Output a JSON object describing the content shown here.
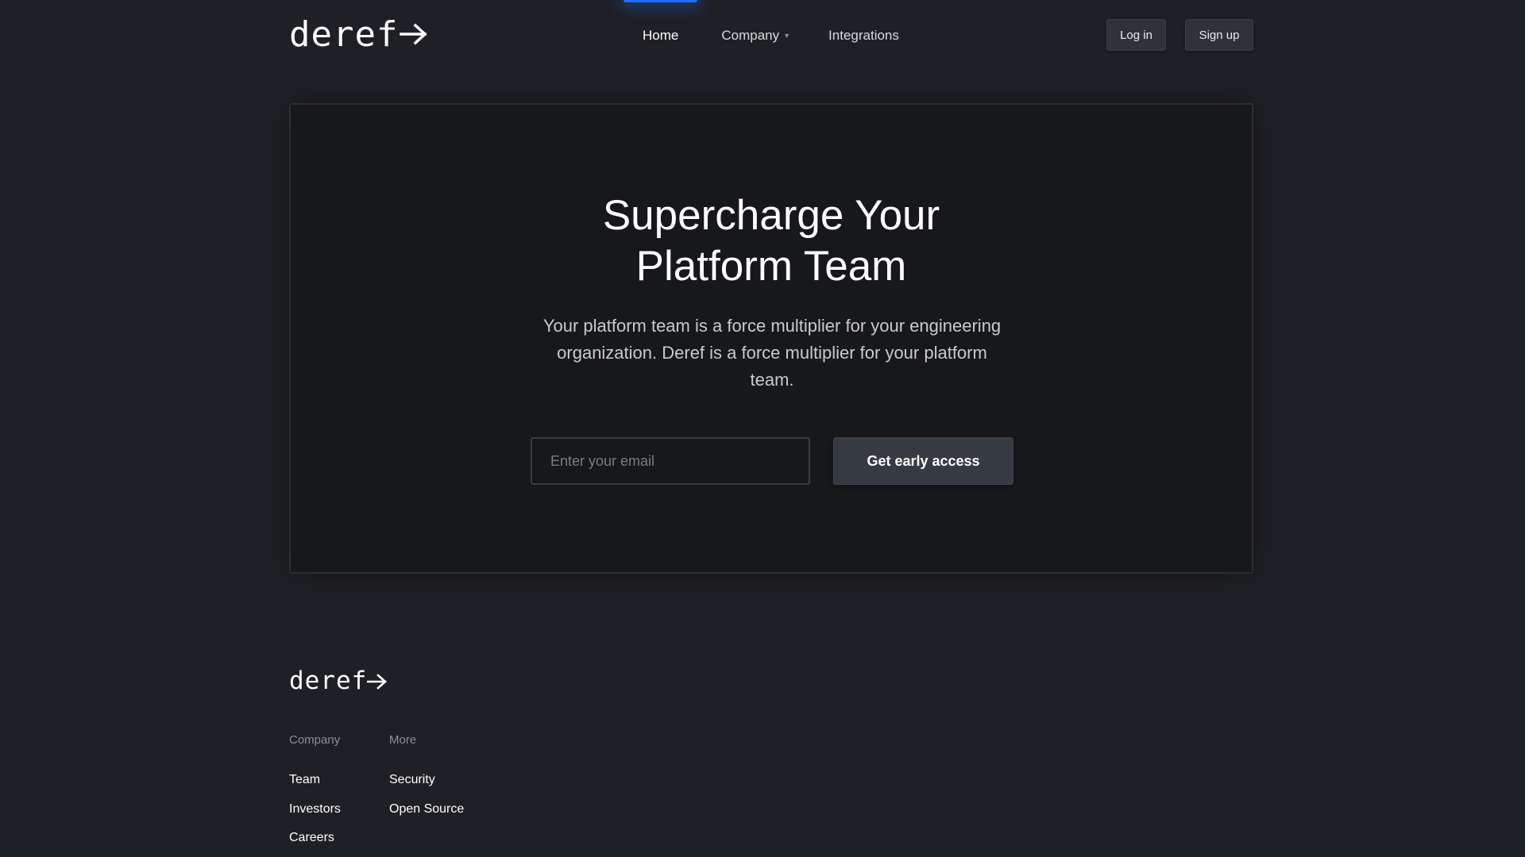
{
  "brand": {
    "logo_text": "deref",
    "logo_arrow": "->"
  },
  "nav": {
    "items": [
      {
        "label": "Home",
        "active": true
      },
      {
        "label": "Company",
        "has_dropdown": true,
        "caret": "▼"
      },
      {
        "label": "Integrations"
      }
    ]
  },
  "auth": {
    "login_label": "Log in",
    "signup_label": "Sign up"
  },
  "hero": {
    "title_line1": "Supercharge Your",
    "title_line2": "Platform Team",
    "subtitle": "Your platform team is a force multiplier for your engineering organization. Deref is a force multiplier for your platform team.",
    "email_placeholder": "Enter your email",
    "cta_label": "Get early access"
  },
  "footer": {
    "logo_text": "deref",
    "columns": [
      {
        "heading": "Company",
        "links": [
          "Team",
          "Investors",
          "Careers"
        ]
      },
      {
        "heading": "More",
        "links": [
          "Security",
          "Open Source"
        ]
      }
    ]
  },
  "colors": {
    "background": "#1f2025",
    "card": "#17181b",
    "accent": "#1f6fff",
    "button": "#363a42"
  }
}
